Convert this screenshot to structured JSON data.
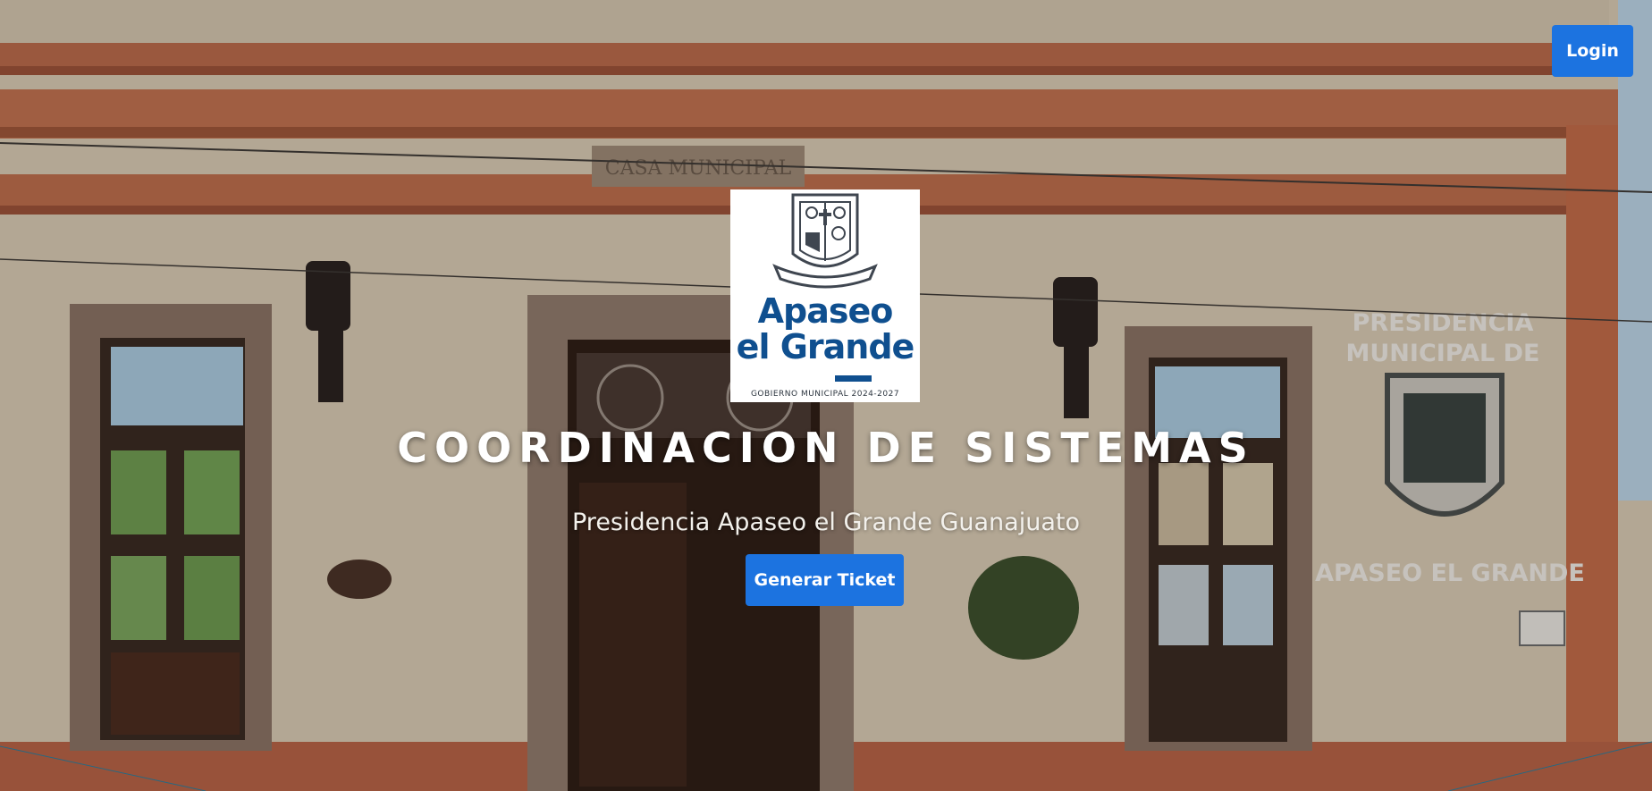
{
  "header": {
    "login_label": "Login"
  },
  "hero": {
    "title": "COORDINACION DE SISTEMAS",
    "subtitle": "Presidencia Apaseo el Grande Guanajuato",
    "cta_label": "Generar Ticket",
    "background_image": "municipal-building-facade",
    "building_plaque_1": "PRESIDENCIA",
    "building_plaque_2": "MUNICIPAL DE",
    "building_plaque_3": "APASEO EL GRANDE",
    "building_sign_top": "CASA MUNICIPAL"
  },
  "logo": {
    "line1": "Apaseo",
    "line2": "el Grande",
    "caption": "GOBIERNO MUNICIPAL 2024-2027",
    "crest_icon": "municipal-coat-of-arms-icon"
  },
  "colors": {
    "primary_button": "#1c73e0",
    "logo_blue": "#0f4f8f",
    "wall": "#d9cbb3",
    "cornice": "#b8694a",
    "door": "#3b2419"
  }
}
